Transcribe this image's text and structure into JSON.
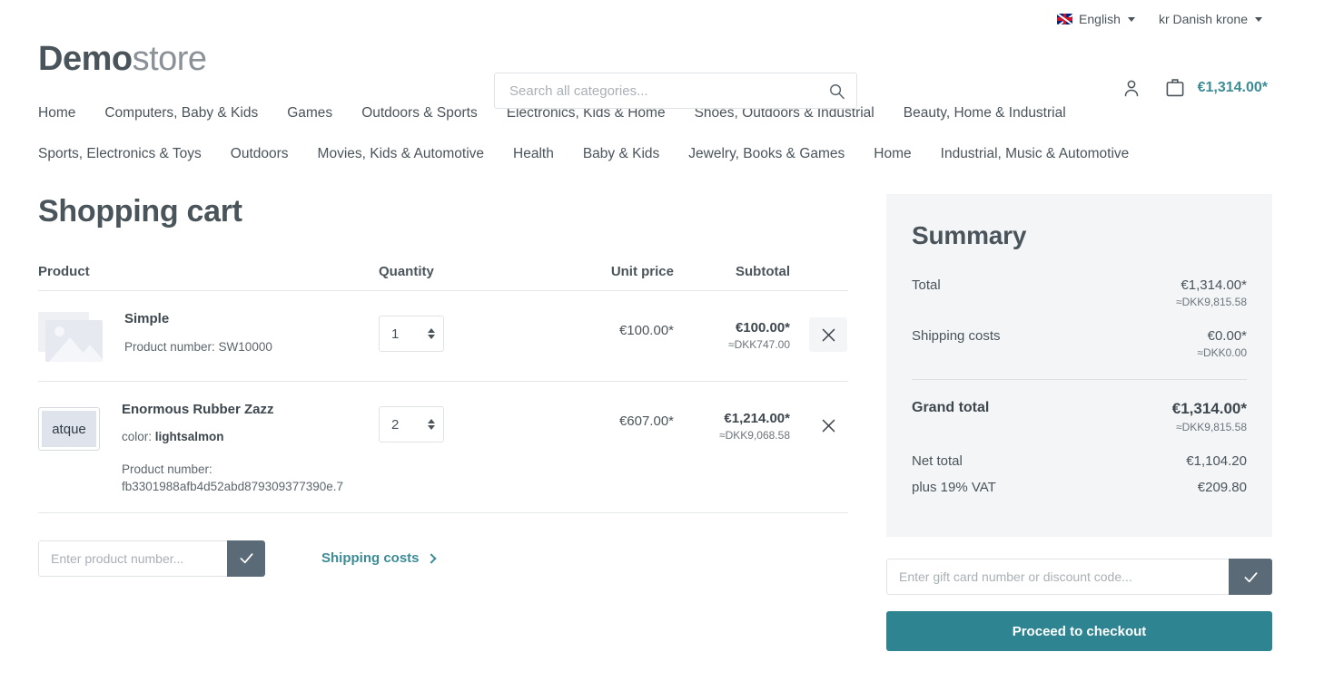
{
  "topbar": {
    "language": {
      "label": "English",
      "icon": "uk-flag-icon"
    },
    "currency": {
      "label": "kr Danish krone"
    }
  },
  "header": {
    "logo_bold": "Demo",
    "logo_light": "store",
    "search": {
      "placeholder": "Search all categories...",
      "value": "",
      "icon": "search-icon"
    },
    "account_icon": "user-icon",
    "cart_icon": "cart-bag-icon",
    "cart_total": "€1,314.00*"
  },
  "nav": {
    "row1": [
      "Home",
      "Computers, Baby & Kids",
      "Games",
      "Outdoors & Sports",
      "Electronics, Kids & Home",
      "Shoes, Outdoors & Industrial",
      "Beauty, Home & Industrial"
    ],
    "row2": [
      "Sports, Electronics & Toys",
      "Outdoors",
      "Movies, Kids & Automotive",
      "Health",
      "Baby & Kids",
      "Jewelry, Books & Games",
      "Home",
      "Industrial, Music & Automotive"
    ]
  },
  "cart": {
    "title": "Shopping cart",
    "columns": {
      "product": "Product",
      "quantity": "Quantity",
      "unit_price": "Unit price",
      "subtotal": "Subtotal"
    },
    "items": [
      {
        "name": "Simple",
        "thumb_type": "placeholder",
        "thumb_text": "",
        "variant_label": "",
        "variant_value": "",
        "product_number_label": "Product number: SW10000",
        "quantity": "1",
        "unit_price": "€100.00*",
        "subtotal": "€100.00*",
        "subtotal_alt": "≈DKK747.00",
        "remove_icon": "close-icon"
      },
      {
        "name": "Enormous Rubber Zazz",
        "thumb_type": "text",
        "thumb_text": "atque",
        "variant_label": "color:",
        "variant_value": "lightsalmon",
        "product_number_label": "Product number:",
        "product_number_value": "fb3301988afb4d52abd879309377390e.7",
        "quantity": "2",
        "unit_price": "€607.00*",
        "subtotal": "€1,214.00*",
        "subtotal_alt": "≈DKK9,068.58",
        "remove_icon": "close-icon"
      }
    ],
    "add_product": {
      "placeholder": "Enter product number...",
      "value": "",
      "submit_icon": "check-icon"
    },
    "shipping_link": "Shipping costs"
  },
  "summary": {
    "title": "Summary",
    "rows": [
      {
        "label": "Total",
        "value": "€1,314.00*",
        "alt": "≈DKK9,815.58"
      },
      {
        "label": "Shipping costs",
        "value": "€0.00*",
        "alt": "≈DKK0.00"
      }
    ],
    "grand": {
      "label": "Grand total",
      "value": "€1,314.00*",
      "alt": "≈DKK9,815.58"
    },
    "net_total": {
      "label": "Net total",
      "value": "€1,104.20"
    },
    "vat": {
      "label": "plus 19% VAT",
      "value": "€209.80"
    },
    "gift_card": {
      "placeholder": "Enter gift card number or discount code...",
      "value": "",
      "submit_icon": "check-icon"
    },
    "checkout_label": "Proceed to checkout"
  },
  "colors": {
    "accent_teal": "#3c8c96",
    "checkout_teal": "#2e8591",
    "text": "#4a545b",
    "panel_bg": "#f4f5f7",
    "button_slate": "#5a6a77"
  }
}
